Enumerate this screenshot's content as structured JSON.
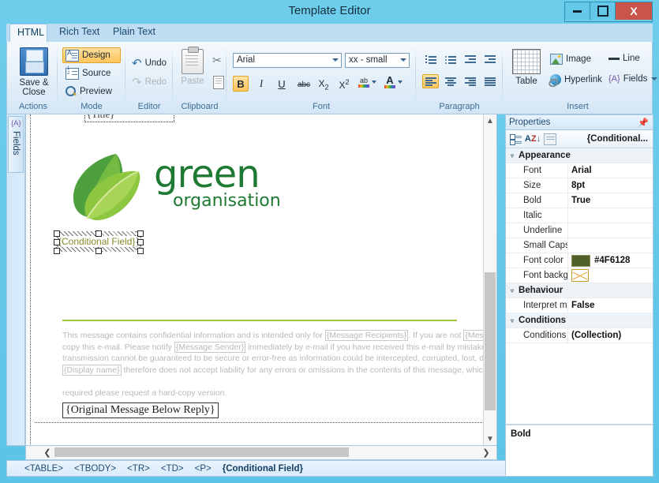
{
  "window": {
    "title": "Template Editor",
    "buttons": {
      "minimize": "minimize-icon",
      "maximize": "maximize-icon",
      "close": "X"
    }
  },
  "ribbon": {
    "tabs": [
      {
        "label": "HTML",
        "active": true
      },
      {
        "label": "Rich Text",
        "active": false
      },
      {
        "label": "Plain Text",
        "active": false
      }
    ],
    "groups": [
      {
        "name": "Actions",
        "label": "Actions",
        "items": [
          {
            "label": "Save &\nClose",
            "icon": "floppy-disk-icon"
          }
        ]
      },
      {
        "name": "Mode",
        "label": "Mode",
        "items": [
          {
            "label": "Design",
            "icon": "design-view-icon",
            "selected": true
          },
          {
            "label": "Source",
            "icon": "source-view-icon",
            "selected": false
          },
          {
            "label": "Preview",
            "icon": "magnifier-icon",
            "selected": false
          }
        ]
      },
      {
        "name": "Editor",
        "label": "Editor",
        "items": [
          {
            "label": "Undo",
            "icon": "undo-arrow-icon",
            "disabled": false
          },
          {
            "label": "Redo",
            "icon": "redo-arrow-icon",
            "disabled": true
          }
        ]
      },
      {
        "name": "Clipboard",
        "label": "Clipboard",
        "items": [
          {
            "label": "Paste",
            "icon": "clipboard-icon",
            "disabled": true
          },
          {
            "label": "",
            "icon": "scissors-icon"
          },
          {
            "label": "",
            "icon": "copy-icon"
          }
        ]
      },
      {
        "name": "Font",
        "label": "Font",
        "font_family_value": "Arial",
        "font_size_value": "xx - small",
        "buttons": [
          {
            "label": "B",
            "name": "bold-button",
            "selected": true
          },
          {
            "label": "I",
            "name": "italic-button",
            "selected": false
          },
          {
            "label": "U",
            "name": "underline-button",
            "selected": false
          },
          {
            "label": "abc",
            "name": "strikethrough-button",
            "selected": false
          },
          {
            "label": "X2",
            "name": "subscript-button",
            "selected": false
          },
          {
            "label": "X2",
            "name": "superscript-button",
            "selected": false
          },
          {
            "label": "ab",
            "name": "highlight-color-button",
            "selected": false
          },
          {
            "label": "A",
            "name": "font-color-button",
            "selected": false
          }
        ]
      },
      {
        "name": "Paragraph",
        "label": "Paragraph",
        "buttons": [
          {
            "name": "numbered-list-button"
          },
          {
            "name": "bulleted-list-button"
          },
          {
            "name": "decrease-indent-button"
          },
          {
            "name": "increase-indent-button"
          },
          {
            "name": "align-left-button",
            "selected": true
          },
          {
            "name": "align-center-button"
          },
          {
            "name": "align-right-button"
          },
          {
            "name": "align-justify-button"
          }
        ]
      },
      {
        "name": "Insert",
        "label": "Insert",
        "items": [
          {
            "label": "Table",
            "icon": "table-icon"
          },
          {
            "label": "Image",
            "icon": "image-icon"
          },
          {
            "label": "Hyperlink",
            "icon": "globe-link-icon"
          },
          {
            "label": "Line",
            "icon": "horizontal-line-icon"
          },
          {
            "label": "Fields",
            "icon": "fields-icon",
            "has_dropdown": true
          }
        ]
      }
    ]
  },
  "left_panel": {
    "tab_label": "Fields",
    "tab_icon": "{A}"
  },
  "document": {
    "title_field": "{Title}",
    "logo": {
      "word": "green",
      "sub": "organisation",
      "leaf_icon": "leaf-logo-icon"
    },
    "selected_field": "{Conditional Field}",
    "rule_color": "#9AC93C",
    "disclaimer": {
      "line1_a": "This message contains confidential information and is intended only for ",
      "token1": "{Message Recipients}",
      "line1_b": ". If you are not ",
      "token2": "{Messag",
      "line2_a": "copy this e-mail. Please notify ",
      "token3": "{Message Sender}",
      "line2_b": " immediately by e-mail if you have received this e-mail by mistake a",
      "line3": "transmission cannot be guaranteed to be secure or error-free as information could be intercepted, corrupted, lost, dest",
      "token4": "{Display name}",
      "line4_b": " therefore does not accept liability for any errors or omissions in the contents of this message, which ari",
      "line5": "required please request a hard-copy version."
    },
    "original_message_field": "{Original Message Below Reply}"
  },
  "properties": {
    "header": "Properties",
    "pin_icon": "pin-icon",
    "toolbar": {
      "categorized_icon": "categorized-view-icon",
      "alphabetical_icon": "alphabetical-sort-icon",
      "property_pages_icon": "property-pages-icon",
      "selected_object": "{Conditional..."
    },
    "categories": [
      {
        "name": "Appearance",
        "rows": [
          {
            "key": "Font",
            "value": "Arial"
          },
          {
            "key": "Size",
            "value": "8pt"
          },
          {
            "key": "Bold",
            "value": "True"
          },
          {
            "key": "Italic",
            "value": ""
          },
          {
            "key": "Underline",
            "value": ""
          },
          {
            "key": "Small Caps",
            "value": ""
          },
          {
            "key": "Font color",
            "value": "#4F6128",
            "swatch": "#4F6128"
          },
          {
            "key": "Font backg",
            "value": "",
            "swatch_empty": true
          }
        ]
      },
      {
        "name": "Behaviour",
        "rows": [
          {
            "key": "Interpret m",
            "value": "False"
          }
        ]
      },
      {
        "name": "Conditions",
        "rows": [
          {
            "key": "Conditions",
            "value": "(Collection)"
          }
        ]
      }
    ],
    "description": "Bold"
  },
  "statusbar": {
    "path": [
      "<TABLE>",
      "<TBODY>",
      "<TR>",
      "<TD>"
    ],
    "tag5": "<P>",
    "current": "{Conditional Field}"
  }
}
